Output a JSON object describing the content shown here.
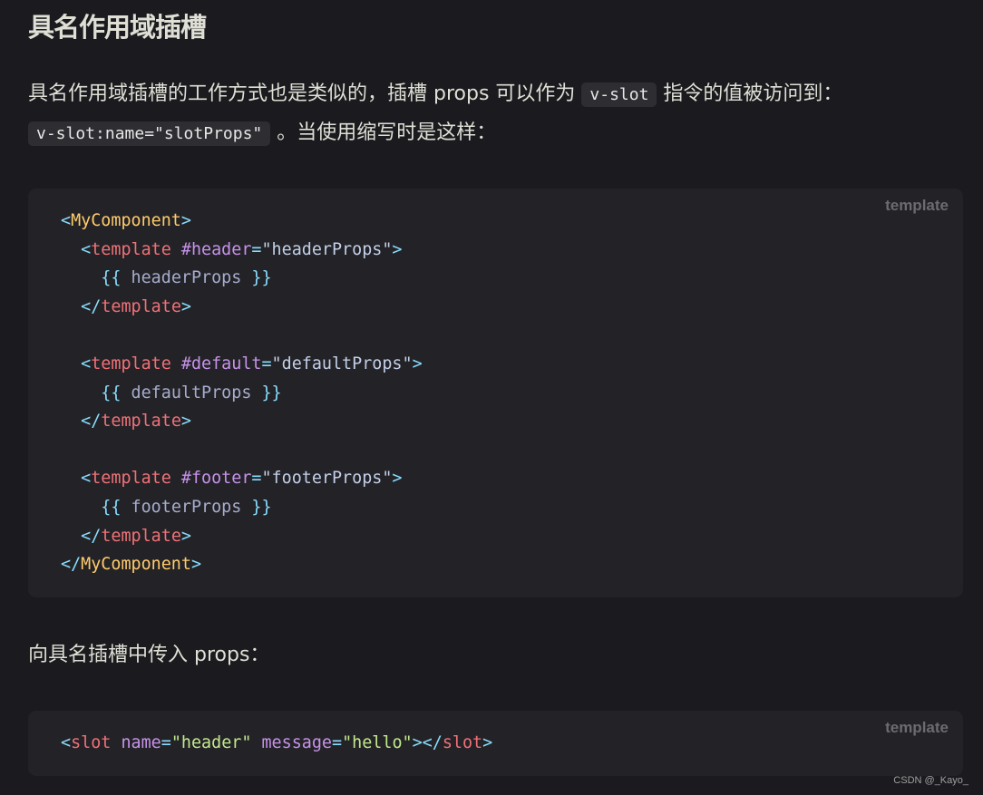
{
  "heading": "具名作用域插槽",
  "paragraph1": {
    "part1": "具名作用域插槽的工作方式也是类似的，插槽 props 可以作为 ",
    "code1": "v-slot",
    "part2": " 指令的值被访问到：",
    "code2": "v-slot:name=\"slotProps\"",
    "part3": " 。当使用缩写时是这样："
  },
  "code_block_1": {
    "language": "template",
    "lines": [
      "<MyComponent>",
      "  <template #header=\"headerProps\">",
      "    {{ headerProps }}",
      "  </template>",
      "",
      "  <template #default=\"defaultProps\">",
      "    {{ defaultProps }}",
      "  </template>",
      "",
      "  <template #footer=\"footerProps\">",
      "    {{ footerProps }}",
      "  </template>",
      "</MyComponent>"
    ]
  },
  "paragraph2": "向具名插槽中传入 props：",
  "code_block_2": {
    "language": "template",
    "lines": [
      "<slot name=\"header\" message=\"hello\"></slot>"
    ]
  },
  "watermark": "CSDN @_Kayo_"
}
